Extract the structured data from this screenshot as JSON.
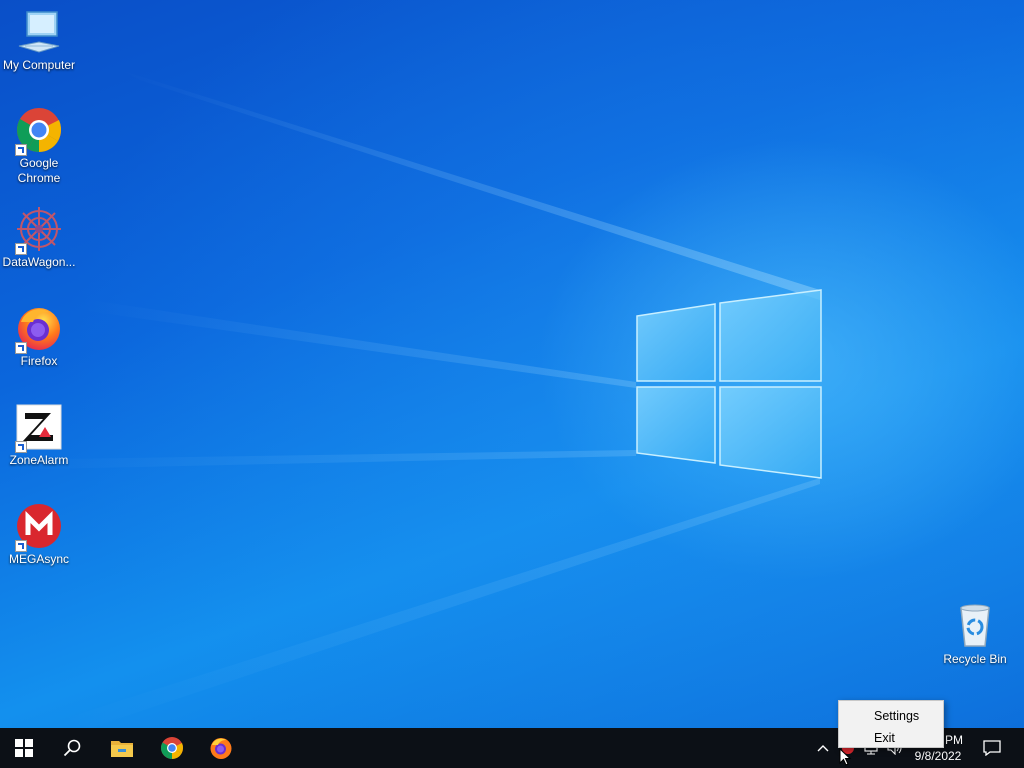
{
  "desktop": {
    "icons": [
      {
        "label": "My Computer",
        "icon": "computer-icon"
      },
      {
        "label": "Google Chrome",
        "icon": "chrome-icon"
      },
      {
        "label": "DataWagon...",
        "icon": "datawagon-icon"
      },
      {
        "label": "Firefox",
        "icon": "firefox-icon"
      },
      {
        "label": "ZoneAlarm",
        "icon": "zonealarm-icon"
      },
      {
        "label": "MEGAsync",
        "icon": "megasync-icon"
      },
      {
        "label": "Recycle Bin",
        "icon": "recycle-bin-icon"
      }
    ]
  },
  "context_menu": {
    "items": [
      {
        "label": "Settings"
      },
      {
        "label": "Exit"
      }
    ]
  },
  "taskbar": {
    "apps": [
      {
        "icon": "file-explorer-icon"
      },
      {
        "icon": "chrome-icon"
      },
      {
        "icon": "firefox-icon"
      }
    ],
    "clock": {
      "time_partial": "PM",
      "date": "9/8/2022"
    }
  },
  "colors": {
    "taskbar": "#0c1016",
    "desktop_blue": "#0b66dc",
    "menu_bg": "#f2f2f2"
  }
}
